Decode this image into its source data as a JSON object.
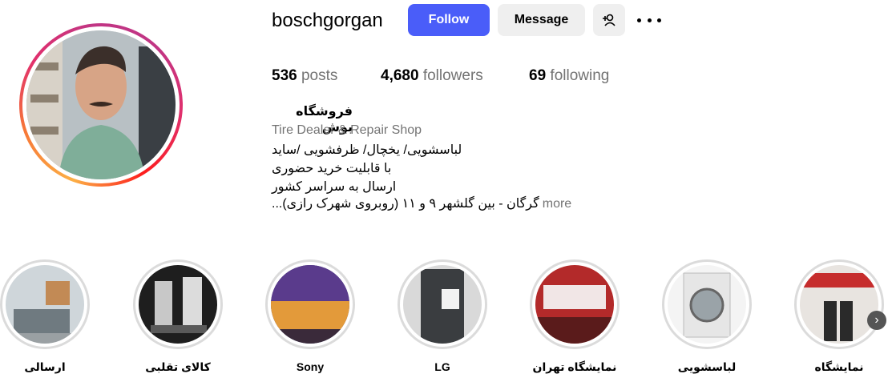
{
  "profile": {
    "username": "boschgorgan",
    "follow_label": "Follow",
    "message_label": "Message",
    "add_user_icon": "person-add-icon",
    "options_icon": "more-horizontal-icon",
    "stats": {
      "posts_count": "536",
      "posts_label": "posts",
      "followers_count": "4,680",
      "followers_label": "followers",
      "following_count": "69",
      "following_label": "following"
    },
    "full_name": "فروشگاه بوش",
    "category": "Tire Dealer & Repair Shop",
    "bio_lines": [
      "لباسشویی/ یخچال/ ظرفشویی /ساید",
      "با قابلیت خرید حضوری",
      "ارسال به سراسر کشور",
      "گرگان - بین گلشهر ۹ و ۱۱ (روبروی شهرک رازی)..."
    ],
    "bio_more": "more"
  },
  "highlights": [
    {
      "label": "ارسالی"
    },
    {
      "label": "کالای تقلبی"
    },
    {
      "label": "Sony"
    },
    {
      "label": "LG"
    },
    {
      "label": "نمایشگاه تهران"
    },
    {
      "label": "لباسشویی"
    },
    {
      "label": "نمایشگاه"
    }
  ],
  "nav": {
    "next_icon": "chevron-right-icon"
  },
  "colors": {
    "accent": "#4a5df9",
    "muted": "#737373",
    "button_bg": "#efefef"
  }
}
